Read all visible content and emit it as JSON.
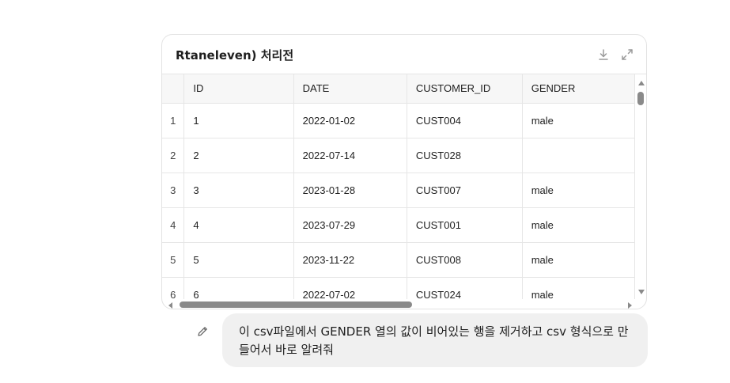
{
  "card": {
    "title": "Rtaneleven) 처리전",
    "download_icon": "download-icon",
    "expand_icon": "expand-icon"
  },
  "table": {
    "columns": [
      "ID",
      "DATE",
      "CUSTOMER_ID",
      "GENDER"
    ],
    "rows": [
      {
        "num": "1",
        "cells": [
          "1",
          "2022-01-02",
          "CUST004",
          "male"
        ]
      },
      {
        "num": "2",
        "cells": [
          "2",
          "2022-07-14",
          "CUST028",
          ""
        ]
      },
      {
        "num": "3",
        "cells": [
          "3",
          "2023-01-28",
          "CUST007",
          "male"
        ]
      },
      {
        "num": "4",
        "cells": [
          "4",
          "2023-07-29",
          "CUST001",
          "male"
        ]
      },
      {
        "num": "5",
        "cells": [
          "5",
          "2023-11-22",
          "CUST008",
          "male"
        ]
      },
      {
        "num": "6",
        "cells": [
          "6",
          "2022-07-02",
          "CUST024",
          "male"
        ]
      }
    ]
  },
  "message": {
    "edit_icon": "pencil-icon",
    "text": "이 csv파일에서 GENDER 열의 값이 비어있는 행을 제거하고 csv 형식으로 만들어서 바로 알려줘"
  }
}
